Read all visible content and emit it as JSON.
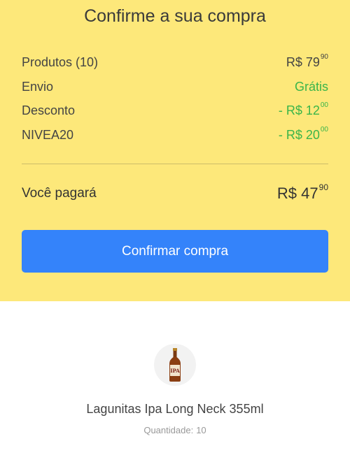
{
  "title": "Confirme a sua compra",
  "rows": [
    {
      "label": "Produtos (10)",
      "value_main": "R$ 79",
      "value_cents": "90",
      "color": "#444444"
    },
    {
      "label": "Envio",
      "value_main": "Grátis",
      "value_cents": "",
      "color": "#3ab54a"
    },
    {
      "label": "Desconto",
      "value_main": "- R$ 12",
      "value_cents": "00",
      "color": "#3ab54a"
    },
    {
      "label": "NIVEA20",
      "value_main": "- R$ 20",
      "value_cents": "00",
      "color": "#3ab54a"
    }
  ],
  "total": {
    "label": "Você pagará",
    "value_main": "R$ 47",
    "value_cents": "90"
  },
  "confirm_button": "Confirmar compra",
  "product": {
    "icon": "beer-bottle-icon",
    "label_text": "IPA",
    "name": "Lagunitas Ipa Long Neck 355ml",
    "quantity_label": "Quantidade:",
    "quantity_value": "10"
  },
  "colors": {
    "summary_bg": "#fde87a",
    "button_bg": "#3483fa",
    "discount_green": "#3ab54a"
  }
}
